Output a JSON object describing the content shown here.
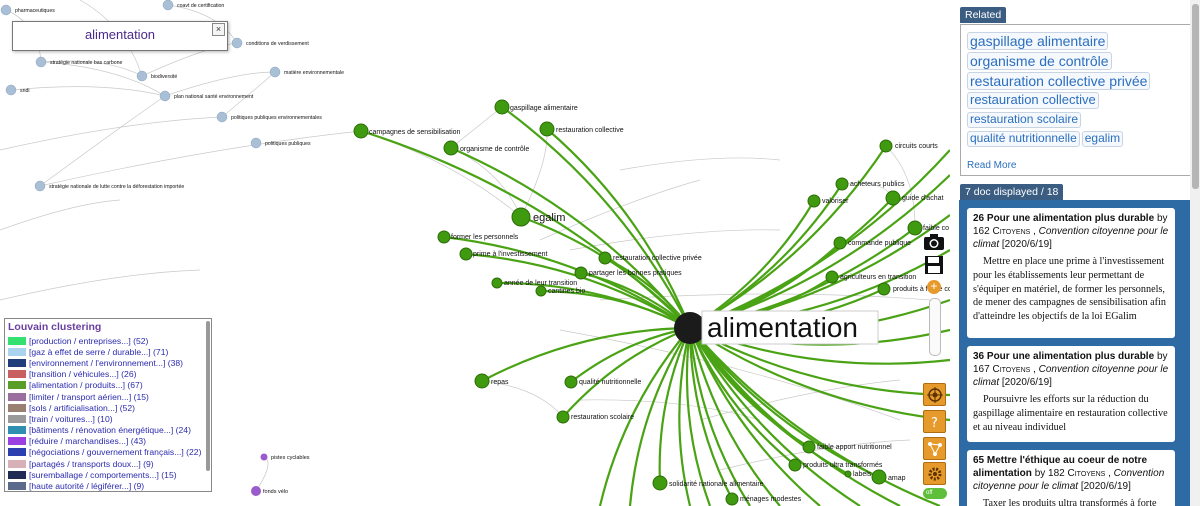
{
  "search": {
    "value": "alimentation",
    "close_label": "×"
  },
  "graph": {
    "center": {
      "label": "alimentation"
    },
    "green_nodes": [
      {
        "label": "gaspillage alimentaire"
      },
      {
        "label": "restauration collective"
      },
      {
        "label": "campagnes de sensibilisation"
      },
      {
        "label": "organisme de contrôle"
      },
      {
        "label": "egalim"
      },
      {
        "label": "former les personnels"
      },
      {
        "label": "prime à l'investissement"
      },
      {
        "label": "restauration collective privée"
      },
      {
        "label": "partager les bonnes pratiques"
      },
      {
        "label": "année de leur transition"
      },
      {
        "label": "cantines bio"
      },
      {
        "label": "circuits courts"
      },
      {
        "label": "acheteurs publics"
      },
      {
        "label": "valoriser"
      },
      {
        "label": "guide d'achat"
      },
      {
        "label": "faible co"
      },
      {
        "label": "commande publique"
      },
      {
        "label": "agriculteurs en transition"
      },
      {
        "label": "produits à faible coû"
      },
      {
        "label": "repas"
      },
      {
        "label": "qualité nutritionnelle"
      },
      {
        "label": "restauration scolaire"
      },
      {
        "label": "faible apport nutritionnel"
      },
      {
        "label": "produits ultra transformés"
      },
      {
        "label": "amap"
      },
      {
        "label": "solidarité nationale alimentaire"
      },
      {
        "label": "ménages modestes"
      },
      {
        "label": "labels"
      }
    ],
    "blue_nodes": [
      {
        "label": "pharmaceutiques"
      },
      {
        "label": "coavt de certification"
      },
      {
        "label": "conditions de verdissement"
      },
      {
        "label": "stratégie nationale bas carbone"
      },
      {
        "label": "biodiversité"
      },
      {
        "label": "matière environnementale"
      },
      {
        "label": "sndi"
      },
      {
        "label": "plan national santé environnement"
      },
      {
        "label": "politiques publiques environnementales"
      },
      {
        "label": "politiques publiques"
      },
      {
        "label": "stratégie nationale de lutte contre la déforestation importée"
      }
    ],
    "purple_nodes": [
      {
        "label": "pistes cyclables"
      },
      {
        "label": "fonds vélo"
      }
    ],
    "colors": {
      "green": "#3f9a10",
      "edge_green": "#4aa314",
      "blue": "#a9bfd6",
      "purple": "#9a5ccc",
      "center": "#1b1b1b"
    }
  },
  "legend": {
    "title": "Louvain clustering",
    "items": [
      {
        "label": "[production / entreprises...] (52)",
        "color": "#33e070"
      },
      {
        "label": "[gaz à effet de serre / durable...] (71)",
        "color": "#a9d3ee"
      },
      {
        "label": "[environnement / l'environnement...] (38)",
        "color": "#1f3d7a"
      },
      {
        "label": "[transition / véhicules...] (26)",
        "color": "#c96060"
      },
      {
        "label": "[alimentation / produits...] (67)",
        "color": "#5a9e2a"
      },
      {
        "label": "[limiter / transport aérien...] (15)",
        "color": "#9a6fa0"
      },
      {
        "label": "[sols / artificialisation...] (52)",
        "color": "#9a8070"
      },
      {
        "label": "[train / voitures...] (10)",
        "color": "#9a9a9a"
      },
      {
        "label": "[bâtiments / rénovation énergétique...] (24)",
        "color": "#2f8fb0"
      },
      {
        "label": "[réduire / marchandises...] (43)",
        "color": "#9a3fe0"
      },
      {
        "label": "[négociations / gouvernement français...] (22)",
        "color": "#2b3fb0"
      },
      {
        "label": "[partagés / transports doux...] (9)",
        "color": "#d8b0b8"
      },
      {
        "label": "[suremballage / comportements...] (15)",
        "color": "#1f2b55"
      },
      {
        "label": "[haute autorité / légiférer...] (9)",
        "color": "#5a6a8a"
      }
    ]
  },
  "tools": {
    "camera_icon": "camera-icon",
    "save_icon": "save-icon",
    "zoom_in": "+",
    "zoom_out": "−",
    "toggle_label": "off"
  },
  "related": {
    "tab": "Related",
    "tags": [
      {
        "label": "gaspillage alimentaire",
        "size": 14
      },
      {
        "label": "organisme de contrôle",
        "size": 14
      },
      {
        "label": "restauration collective privée",
        "size": 14
      },
      {
        "label": "restauration collective",
        "size": 13
      },
      {
        "label": "restauration scolaire",
        "size": 12
      },
      {
        "label": "qualité nutritionnelle",
        "size": 12
      },
      {
        "label": "egalim",
        "size": 12
      }
    ],
    "read_more": "Read More"
  },
  "docs": {
    "tab": "7 doc displayed / 18",
    "items": [
      {
        "num": "26",
        "title": "Pour une alimentation plus durable",
        "by": "by",
        "count": "162",
        "source": "Citoyens",
        "collection": "Convention citoyenne pour le climat",
        "date": "[2020/6/19]",
        "body": "Mettre en place une prime à l'investissement pour les établissements leur permettant de s'équiper en matériel, de former les personnels, de mener des campagnes de sensibilisation afin d'atteindre les objectifs de la loi EGalim"
      },
      {
        "num": "36",
        "title": "Pour une alimentation plus durable",
        "by": "by",
        "count": "167",
        "source": "Citoyens",
        "collection": "Convention citoyenne pour le climat",
        "date": "[2020/6/19]",
        "body": "Poursuivre les efforts sur la réduction du gaspillage alimentaire en restauration collective et au niveau individuel"
      },
      {
        "num": "65",
        "title": "Mettre l'éthique au coeur de notre alimentation",
        "by": "by",
        "count": "182",
        "source": "Citoyens",
        "collection": "Convention citoyenne pour le climat",
        "date": "[2020/6/19]",
        "body": "Taxer les produits ultra transformés à forte"
      }
    ]
  }
}
